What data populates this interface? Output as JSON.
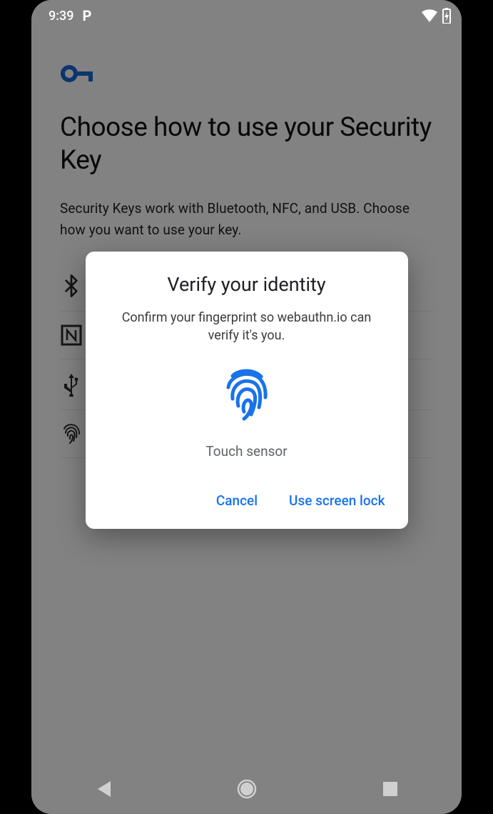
{
  "statusbar": {
    "time": "9:39",
    "p_glyph": "P"
  },
  "page": {
    "title": "Choose how to use your Security Key",
    "subtitle": "Security Keys work with Bluetooth, NFC, and USB. Choose how you want to use your key.",
    "options": [
      {
        "icon": "bluetooth",
        "label": ""
      },
      {
        "icon": "nfc",
        "label": ""
      },
      {
        "icon": "usb",
        "label": ""
      },
      {
        "icon": "fingerprint",
        "label": ""
      }
    ]
  },
  "dialog": {
    "title": "Verify your identity",
    "body": "Confirm your fingerprint so webauthn.io can verify it's you.",
    "sensor_text": "Touch sensor",
    "actions": {
      "cancel": "Cancel",
      "screen_lock": "Use screen lock"
    }
  },
  "colors": {
    "accent": "#1a73e8",
    "fp_blue": "#1a73e8",
    "key_blue": "#1967d2"
  }
}
